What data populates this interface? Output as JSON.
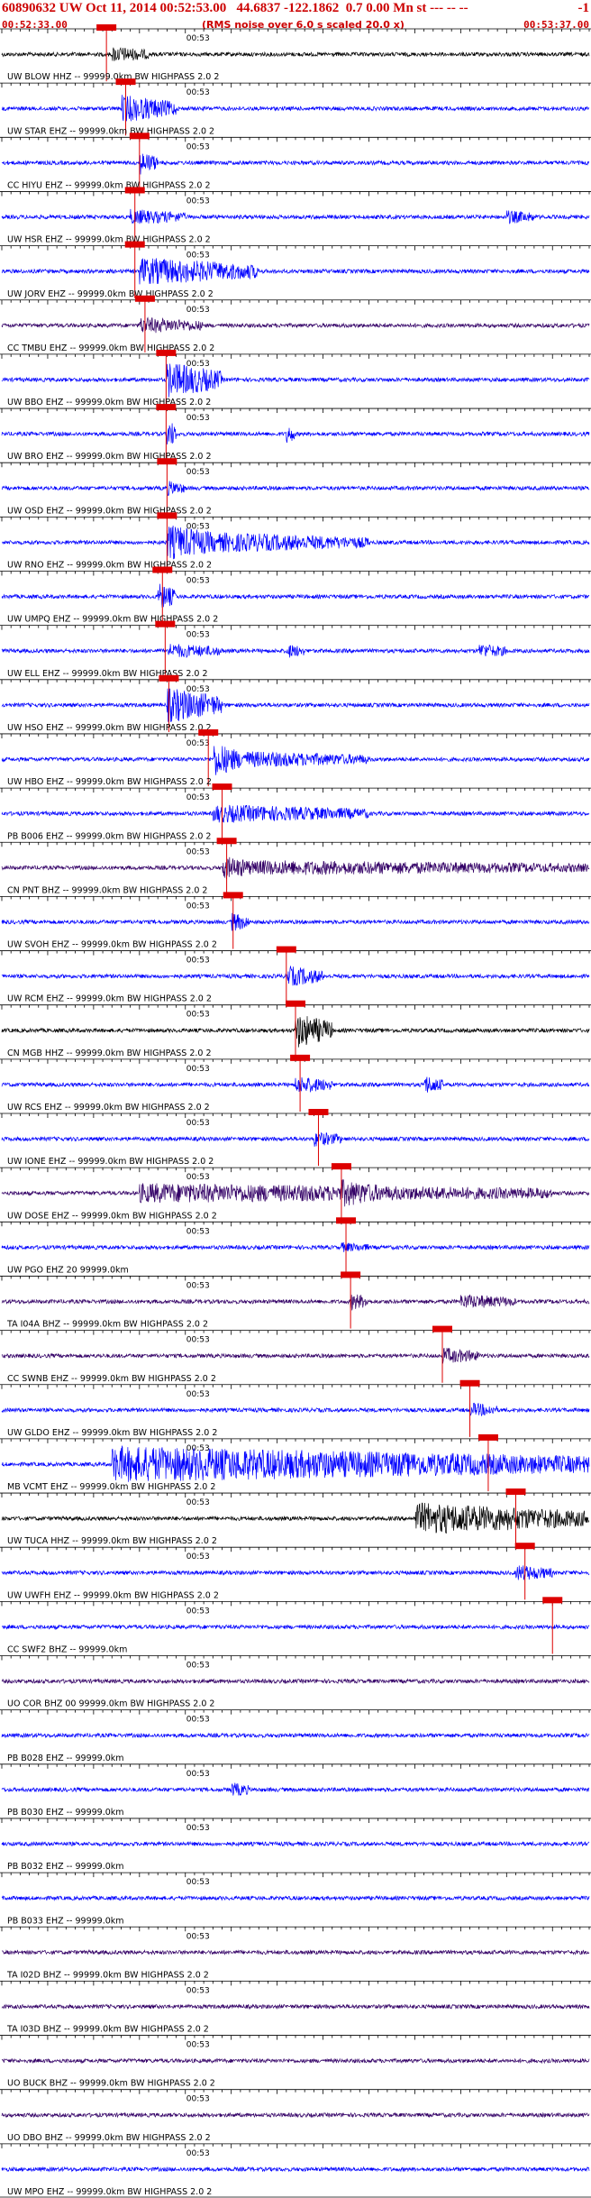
{
  "header": {
    "line1": "60890632 UW Oct 11, 2014 00:52:53.00   44.6837 -122.1862  0.7 0.00 Mn st --- -- --",
    "line1_end": "-1",
    "start_time": "00:52:33.00",
    "note": "(RMS noise over 6.0 s scaled 20.0 x)",
    "end_time": "00:53:37.00"
  },
  "chart_data": {
    "type": "line",
    "title": "60890632 UW Oct 11, 2014 00:52:53.00",
    "time_window": [
      "00:52:33.00",
      "00:53:37.00"
    ],
    "tick_label": "00:53",
    "channels": [
      {
        "label": "UW BLOW HHZ -- 99999.0km BW  HIGHPASS  2.0  2",
        "color": "#000000",
        "pick_sec": 11.4,
        "bursts": [
          [
            12,
            16,
            1.6
          ]
        ]
      },
      {
        "label": "UW STAR EHZ -- 99999.0km BW  HIGHPASS  2.0  2",
        "color": "#0000ff",
        "pick_sec": 13.5,
        "bursts": [
          [
            13,
            19,
            3.0
          ]
        ]
      },
      {
        "label": "CC HIYU EHZ -- 99999.0km BW  HIGHPASS  2.0  2",
        "color": "#0000ff",
        "pick_sec": 15.0,
        "bursts": [
          [
            15,
            17,
            2.5
          ]
        ]
      },
      {
        "label": "UW HSR EHZ -- 99999.0km BW  HIGHPASS  2.0  2",
        "color": "#0000ff",
        "pick_sec": 14.5,
        "bursts": [
          [
            14,
            20,
            1.5
          ],
          [
            55,
            58,
            1.3
          ]
        ]
      },
      {
        "label": "UW JORV EHZ -- 99999.0km BW  HIGHPASS  2.0  2",
        "color": "#0000ff",
        "pick_sec": 14.5,
        "bursts": [
          [
            15,
            28,
            3.0
          ]
        ]
      },
      {
        "label": "CC TMBU EHZ -- 99999.0km BW  HIGHPASS  2.0  2",
        "color": "#330066",
        "pick_sec": 15.6,
        "bursts": [
          [
            15,
            22,
            1.6
          ]
        ]
      },
      {
        "label": "UW BBO EHZ -- 99999.0km BW  HIGHPASS  2.0  2",
        "color": "#0000ff",
        "pick_sec": 17.9,
        "bursts": [
          [
            18,
            24,
            4.0
          ]
        ]
      },
      {
        "label": "UW BRO EHZ -- 99999.0km BW  HIGHPASS  2.0  2",
        "color": "#0000ff",
        "pick_sec": 17.9,
        "bursts": [
          [
            18,
            19,
            3.5
          ],
          [
            31,
            32,
            2.0
          ]
        ]
      },
      {
        "label": "UW OSD EHZ -- 99999.0km BW  HIGHPASS  2.0  2",
        "color": "#0000ff",
        "pick_sec": 18.0,
        "bursts": [
          [
            18,
            20,
            1.4
          ]
        ]
      },
      {
        "label": "UW RNO EHZ -- 99999.0km BW  HIGHPASS  2.0  2",
        "color": "#0000ff",
        "pick_sec": 18.0,
        "bursts": [
          [
            18,
            24,
            4.0
          ],
          [
            24,
            40,
            2.0
          ]
        ]
      },
      {
        "label": "UW UMPQ EHZ -- 99999.0km BW  HIGHPASS  2.0  2",
        "color": "#0000ff",
        "pick_sec": 17.5,
        "bursts": [
          [
            17,
            19,
            3.0
          ]
        ]
      },
      {
        "label": "UW ELL EHZ -- 99999.0km BW  HIGHPASS  2.0  2",
        "color": "#0000ff",
        "pick_sec": 17.8,
        "bursts": [
          [
            18,
            24,
            1.4
          ],
          [
            31,
            33,
            1.4
          ],
          [
            52,
            55,
            1.4
          ]
        ]
      },
      {
        "label": "UW HSO EHZ -- 99999.0km BW  HIGHPASS  2.0  2",
        "color": "#0000ff",
        "pick_sec": 18.2,
        "bursts": [
          [
            18,
            24,
            4.0
          ]
        ]
      },
      {
        "label": "UW HBO EHZ -- 99999.0km BW  HIGHPASS  2.0  2",
        "color": "#0000ff",
        "pick_sec": 22.5,
        "bursts": [
          [
            23,
            26,
            4.0
          ],
          [
            26,
            40,
            1.6
          ]
        ]
      },
      {
        "label": "PB B006 EHZ -- 99999.0km BW  HIGHPASS  2.0  2",
        "color": "#0000ff",
        "pick_sec": 24.0,
        "bursts": [
          [
            23,
            40,
            1.8
          ]
        ]
      },
      {
        "label": "CN PNT BHZ -- 99999.0km BW  HIGHPASS  2.0  2",
        "color": "#330066",
        "pick_sec": 24.5,
        "bursts": [
          [
            24,
            28,
            2.5
          ],
          [
            28,
            64,
            1.4
          ]
        ]
      },
      {
        "label": "UW SVOH EHZ -- 99999.0km BW  HIGHPASS  2.0  2",
        "color": "#0000ff",
        "pick_sec": 25.2,
        "bursts": [
          [
            25,
            27,
            2.0
          ]
        ]
      },
      {
        "label": "UW RCM EHZ -- 99999.0km BW  HIGHPASS  2.0  2",
        "color": "#0000ff",
        "pick_sec": 31.0,
        "bursts": [
          [
            31,
            35,
            2.2
          ]
        ]
      },
      {
        "label": "CN MGB HHZ -- 99999.0km BW  HIGHPASS  2.0  2",
        "color": "#000000",
        "pick_sec": 32.0,
        "bursts": [
          [
            32,
            36,
            4.0
          ]
        ]
      },
      {
        "label": "UW RCS EHZ -- 99999.0km BW  HIGHPASS  2.0  2",
        "color": "#0000ff",
        "pick_sec": 32.5,
        "bursts": [
          [
            32,
            36,
            1.8
          ],
          [
            46,
            48,
            2.0
          ]
        ]
      },
      {
        "label": "UW IONE EHZ -- 99999.0km BW  HIGHPASS  2.0  2",
        "color": "#0000ff",
        "pick_sec": 34.5,
        "bursts": [
          [
            34,
            37,
            1.5
          ]
        ]
      },
      {
        "label": "UW DOSE EHZ -- 99999.0km BW  HIGHPASS  2.0  2",
        "color": "#330066",
        "pick_sec": 37.0,
        "bursts": [
          [
            15,
            60,
            2.0
          ],
          [
            37,
            42,
            3.0
          ]
        ]
      },
      {
        "label": "UW PGO EHZ 20 99999.0km",
        "color": "#0000ff",
        "pick_sec": 37.5,
        "bursts": [
          [
            37,
            40,
            0.8
          ]
        ]
      },
      {
        "label": "TA I04A BHZ -- 99999.0km BW  HIGHPASS  2.0  2",
        "color": "#330066",
        "pick_sec": 38.0,
        "bursts": [
          [
            38,
            40,
            1.8
          ],
          [
            50,
            56,
            1.4
          ]
        ]
      },
      {
        "label": "CC SWNB EHZ -- 99999.0km BW  HIGHPASS  2.0  2",
        "color": "#330066",
        "pick_sec": 48.0,
        "bursts": [
          [
            48,
            52,
            1.6
          ]
        ]
      },
      {
        "label": "UW GLDO EHZ -- 99999.0km BW  HIGHPASS  2.0  2",
        "color": "#0000ff",
        "pick_sec": 51.0,
        "bursts": [
          [
            51,
            54,
            1.4
          ]
        ]
      },
      {
        "label": "MB VCMT EHZ -- 99999.0km BW  HIGHPASS  2.0  2",
        "color": "#0000ff",
        "pick_sec": 53.0,
        "bursts": [
          [
            12,
            64,
            4.0
          ]
        ]
      },
      {
        "label": "UW TUCA HHZ -- 99999.0km BW  HIGHPASS  2.0  2",
        "color": "#000000",
        "pick_sec": 56.0,
        "bursts": [
          [
            45,
            64,
            3.5
          ]
        ]
      },
      {
        "label": "UW UWFH EHZ -- 99999.0km BW  HIGHPASS  2.0  2",
        "color": "#0000ff",
        "pick_sec": 57.0,
        "bursts": [
          [
            56,
            60,
            1.6
          ]
        ]
      },
      {
        "label": "CC SWF2 BHZ -- 99999.0km",
        "color": "#0000ff",
        "pick_sec": 60.0,
        "bursts": []
      },
      {
        "label": "UO COR BHZ 00 99999.0km BW  HIGHPASS  2.0  2",
        "color": "#330066",
        "pick_sec": null,
        "bursts": []
      },
      {
        "label": "PB B028 EHZ -- 99999.0km",
        "color": "#0000ff",
        "pick_sec": null,
        "bursts": []
      },
      {
        "label": "PB B030 EHZ -- 99999.0km",
        "color": "#0000ff",
        "pick_sec": null,
        "bursts": [
          [
            25,
            27,
            1.4
          ]
        ]
      },
      {
        "label": "PB B032 EHZ -- 99999.0km",
        "color": "#0000ff",
        "pick_sec": null,
        "bursts": []
      },
      {
        "label": "PB B033 EHZ -- 99999.0km",
        "color": "#0000ff",
        "pick_sec": null,
        "bursts": []
      },
      {
        "label": "TA I02D BHZ -- 99999.0km BW  HIGHPASS  2.0  2",
        "color": "#330066",
        "pick_sec": null,
        "bursts": []
      },
      {
        "label": "TA I03D BHZ -- 99999.0km BW  HIGHPASS  2.0  2",
        "color": "#330066",
        "pick_sec": null,
        "bursts": []
      },
      {
        "label": "UO BUCK BHZ -- 99999.0km BW  HIGHPASS  2.0  2",
        "color": "#330066",
        "pick_sec": null,
        "bursts": []
      },
      {
        "label": "UO DBO BHZ -- 99999.0km BW  HIGHPASS  2.0  2",
        "color": "#330066",
        "pick_sec": null,
        "bursts": []
      },
      {
        "label": "UW MPO EHZ -- 99999.0km BW  HIGHPASS  2.0  2",
        "color": "#0000ff",
        "pick_sec": null,
        "bursts": []
      }
    ],
    "grid": false
  }
}
